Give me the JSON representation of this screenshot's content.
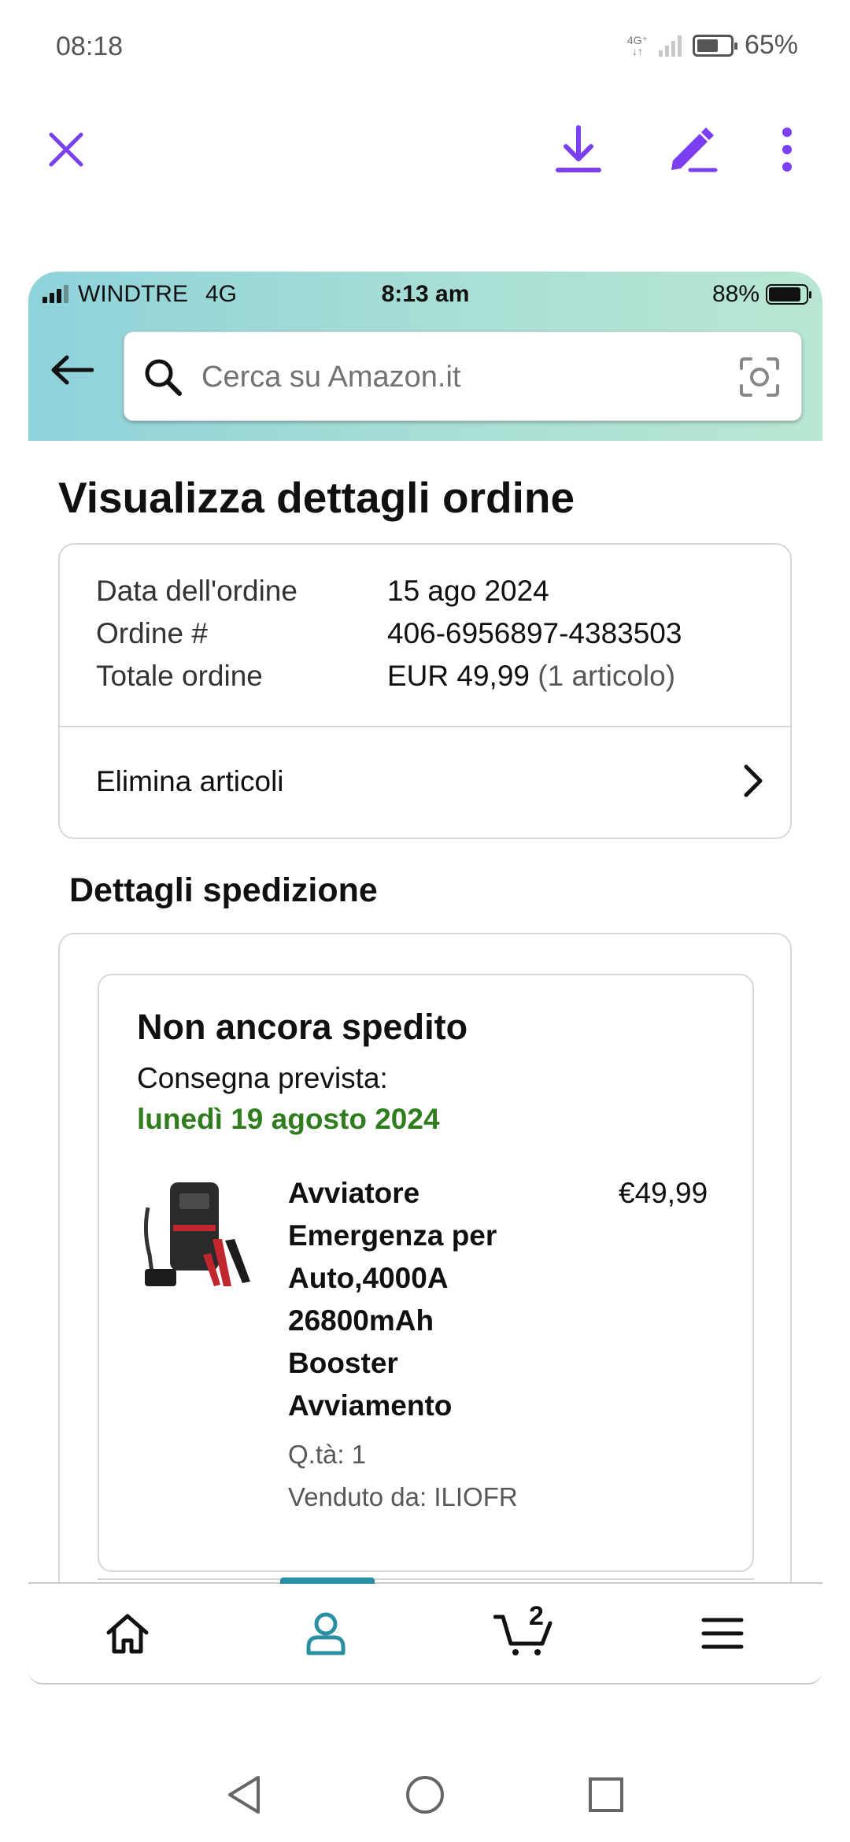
{
  "system_status": {
    "time": "08:18",
    "network_tag": "4G⁺",
    "battery": "65%",
    "battery_level": 0.65
  },
  "viewer_toolbar": {
    "close_icon": "close-icon",
    "download_icon": "download-icon",
    "edit_icon": "edit-pen-icon",
    "more_icon": "more-vert-icon",
    "accent_color": "#7a3ff0"
  },
  "screenshot": {
    "status": {
      "carrier": "WINDTRE",
      "network": "4G",
      "time": "8:13 am",
      "battery": "88%",
      "battery_level": 0.88
    },
    "search": {
      "placeholder": "Cerca su Amazon.it"
    },
    "page_title": "Visualizza dettagli ordine",
    "order_summary": {
      "rows": [
        {
          "label": "Data dell'ordine",
          "value": "15 ago 2024",
          "extra": ""
        },
        {
          "label": "Ordine #",
          "value": "406-6956897-4383503",
          "extra": ""
        },
        {
          "label": "Totale ordine",
          "value": "EUR 49,99",
          "extra": " (1 articolo)"
        }
      ],
      "remove_items_label": "Elimina articoli"
    },
    "shipment": {
      "section_title": "Dettagli spedizione",
      "status": "Non ancora spedito",
      "delivery_label": "Consegna prevista:",
      "delivery_date": "lunedì 19 agosto 2024",
      "delivery_date_color": "#2f7d1f",
      "product": {
        "title": "Avviatore Emergenza per Auto,4000A 26800mAh Booster Avviamento",
        "price": "€49,99",
        "quantity": "Q.tà: 1",
        "seller": "Venduto da: ILIOFR"
      }
    },
    "bottom_nav": {
      "items": [
        "home-icon",
        "account-icon",
        "cart-icon",
        "menu-icon"
      ],
      "cart_count": "2",
      "active_color": "#2b8fa3"
    }
  }
}
